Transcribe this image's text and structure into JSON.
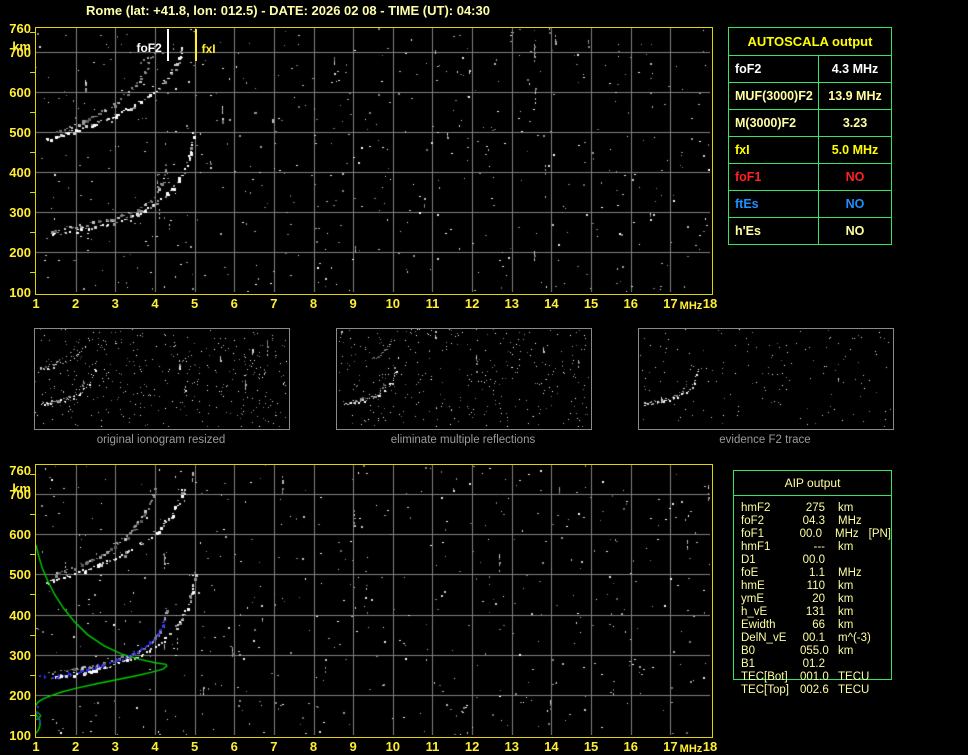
{
  "title": "Rome (lat: +41.8, lon: 012.5) - DATE: 2026 02 08 - TIME (UT): 04:30",
  "colors": {
    "background": "#000000",
    "axis_yellow": "#ffee33",
    "border_yellow": "#e3d400",
    "title_cream": "#ffffaa",
    "table_green": "#35e463",
    "grid_gray": "#808080",
    "caption_gray": "#9a9a9a",
    "value_cream": "#ffffa0",
    "red": "#ff2222",
    "blue": "#1e90ff",
    "profile_green": "#00cf00",
    "restored_trace_blue": "#2d2dff"
  },
  "plot": {
    "x_ticks": [
      "1",
      "2",
      "3",
      "4",
      "5",
      "6",
      "7",
      "8",
      "9",
      "10",
      "11",
      "12",
      "13",
      "14",
      "15",
      "16",
      "17",
      "18"
    ],
    "x_unit": "MHz",
    "y_ticks": [
      {
        "label": "760",
        "km": 760
      },
      {
        "label": "km",
        "km": 716
      },
      {
        "label": "700",
        "km": 700
      },
      {
        "label": "600",
        "km": 600
      },
      {
        "label": "500",
        "km": 500
      },
      {
        "label": "400",
        "km": 400
      },
      {
        "label": "300",
        "km": 300
      },
      {
        "label": "200",
        "km": 200
      },
      {
        "label": "100",
        "km": 100
      }
    ],
    "fof2_label": "foF2",
    "fxi_label": "fxI"
  },
  "autoscala": {
    "header": "AUTOSCALA output",
    "rows": [
      {
        "label": "foF2",
        "value": "4.3 MHz",
        "style": "cw"
      },
      {
        "label": "MUF(3000)F2",
        "value": "13.9 MHz",
        "style": "cc"
      },
      {
        "label": "M(3000)F2",
        "value": "3.23",
        "style": "cc"
      },
      {
        "label": "fxI",
        "value": "5.0 MHz",
        "style": "cy"
      },
      {
        "label": "foF1",
        "value": "NO",
        "style": "cr"
      },
      {
        "label": "ftEs",
        "value": "NO",
        "style": "cb"
      },
      {
        "label": "h'Es",
        "value": "NO",
        "style": "cc"
      }
    ]
  },
  "thumbnails": [
    {
      "caption": "original ionogram resized"
    },
    {
      "caption": "eliminate multiple reflections"
    },
    {
      "caption": "evidence F2 trace"
    }
  ],
  "aip": {
    "header": "AIP output",
    "rows": [
      {
        "name": "hmF2",
        "value": "275",
        "unit": "km",
        "extra": ""
      },
      {
        "name": "foF2",
        "value": "04.3",
        "unit": "MHz",
        "extra": ""
      },
      {
        "name": "foF1",
        "value": "00.0",
        "unit": "MHz",
        "extra": "[PN]"
      },
      {
        "name": "hmF1",
        "value": "---",
        "unit": "km",
        "extra": ""
      },
      {
        "name": "D1",
        "value": "00.0",
        "unit": "",
        "extra": ""
      },
      {
        "name": "foE",
        "value": "1.1",
        "unit": "MHz",
        "extra": ""
      },
      {
        "name": "hmE",
        "value": "110",
        "unit": "km",
        "extra": ""
      },
      {
        "name": "ymE",
        "value": "20",
        "unit": "km",
        "extra": ""
      },
      {
        "name": "h_vE",
        "value": "131",
        "unit": "km",
        "extra": ""
      },
      {
        "name": "Ewidth",
        "value": "66",
        "unit": "km",
        "extra": ""
      },
      {
        "name": "DelN_vE",
        "value": "00.1",
        "unit": "m^(-3)",
        "extra": ""
      },
      {
        "name": "B0",
        "value": "055.0",
        "unit": "km",
        "extra": ""
      },
      {
        "name": "B1",
        "value": "01.2",
        "unit": "",
        "extra": ""
      },
      {
        "name": "TEC[Bot]",
        "value": "001.0",
        "unit": "TECU",
        "extra": ""
      },
      {
        "name": "TEC[Top]",
        "value": "002.6",
        "unit": "TECU",
        "extra": ""
      }
    ]
  },
  "chart_data": {
    "type": "scatter",
    "description": "Ionogram: virtual height (km) vs sounding frequency (MHz), with AUTOSCALA traces",
    "x_axis": {
      "label": "MHz",
      "range": [
        1,
        18
      ],
      "grid_step": 1
    },
    "y_axis": {
      "label": "km",
      "range": [
        100,
        760
      ],
      "grid_step": 100
    },
    "critical": {
      "foF2_MHz": 4.3,
      "fxI_MHz": 5.0,
      "hmF2_km": 275
    },
    "traces": {
      "f2_x": [
        [
          1.4,
          244
        ],
        [
          1.8,
          250
        ],
        [
          2.2,
          257
        ],
        [
          2.6,
          265
        ],
        [
          3.0,
          276
        ],
        [
          3.4,
          289
        ],
        [
          3.7,
          302
        ],
        [
          3.95,
          317
        ],
        [
          4.2,
          335
        ],
        [
          4.4,
          355
        ],
        [
          4.6,
          378
        ],
        [
          4.75,
          404
        ],
        [
          4.85,
          430
        ],
        [
          4.92,
          458
        ],
        [
          4.97,
          488
        ],
        [
          4.99,
          508
        ]
      ],
      "f2_o": [
        [
          1.35,
          254
        ],
        [
          1.7,
          259
        ],
        [
          2.1,
          265
        ],
        [
          2.5,
          273
        ],
        [
          2.9,
          283
        ],
        [
          3.25,
          294
        ],
        [
          3.55,
          307
        ],
        [
          3.8,
          322
        ],
        [
          4.0,
          340
        ],
        [
          4.12,
          360
        ],
        [
          4.2,
          382
        ],
        [
          4.26,
          405
        ],
        [
          4.29,
          428
        ]
      ],
      "hop_o": [
        [
          1.45,
          498
        ],
        [
          1.8,
          510
        ],
        [
          2.15,
          524
        ],
        [
          2.5,
          540
        ],
        [
          2.85,
          560
        ],
        [
          3.15,
          583
        ],
        [
          3.45,
          612
        ],
        [
          3.7,
          645
        ],
        [
          3.9,
          680
        ],
        [
          4.03,
          715
        ]
      ],
      "hop_x": [
        [
          1.25,
          480
        ],
        [
          1.7,
          494
        ],
        [
          2.2,
          510
        ],
        [
          2.7,
          528
        ],
        [
          3.2,
          550
        ],
        [
          3.7,
          578
        ],
        [
          4.1,
          610
        ],
        [
          4.4,
          645
        ],
        [
          4.6,
          682
        ],
        [
          4.73,
          716
        ]
      ],
      "hop_x_upper": [
        [
          3.2,
          550
        ],
        [
          3.7,
          578
        ],
        [
          4.1,
          610
        ],
        [
          4.4,
          645
        ],
        [
          4.6,
          682
        ],
        [
          4.73,
          716
        ]
      ]
    },
    "profile": [
      [
        1.0,
        573
      ],
      [
        1.07,
        545
      ],
      [
        1.16,
        515
      ],
      [
        1.3,
        483
      ],
      [
        1.47,
        450
      ],
      [
        1.7,
        415
      ],
      [
        1.97,
        382
      ],
      [
        2.3,
        350
      ],
      [
        2.72,
        322
      ],
      [
        3.15,
        302
      ],
      [
        3.6,
        289
      ],
      [
        4.0,
        280
      ],
      [
        4.28,
        276
      ],
      [
        4.3,
        272
      ],
      [
        4.2,
        264
      ],
      [
        3.9,
        256
      ],
      [
        3.5,
        247
      ],
      [
        3.0,
        237
      ],
      [
        2.5,
        227
      ],
      [
        2.0,
        216
      ],
      [
        1.65,
        207
      ],
      [
        1.38,
        198
      ],
      [
        1.18,
        190
      ],
      [
        1.05,
        182
      ],
      [
        0.99,
        173
      ],
      [
        0.96,
        163
      ],
      [
        0.99,
        152
      ],
      [
        1.05,
        144
      ],
      [
        1.1,
        136
      ],
      [
        1.1,
        124
      ],
      [
        1.06,
        112
      ],
      [
        1.0,
        105
      ],
      [
        0.95,
        100
      ]
    ],
    "profile_loop": [
      [
        1.05,
        157
      ],
      [
        0.96,
        152
      ],
      [
        0.9,
        145
      ],
      [
        0.96,
        138
      ],
      [
        1.06,
        140
      ],
      [
        1.12,
        148
      ],
      [
        1.06,
        155
      ],
      [
        1.0,
        157
      ],
      [
        1.05,
        157
      ]
    ],
    "blue_trace": [
      [
        1.12,
        247
      ],
      [
        1.3,
        241
      ],
      [
        1.5,
        243
      ],
      [
        1.75,
        249
      ],
      [
        2.05,
        256
      ],
      [
        2.35,
        264
      ],
      [
        2.65,
        272
      ],
      [
        2.95,
        282
      ],
      [
        3.25,
        293
      ],
      [
        3.55,
        307
      ],
      [
        3.8,
        323
      ],
      [
        4.0,
        342
      ],
      [
        4.12,
        360
      ],
      [
        4.22,
        377
      ],
      [
        4.28,
        391
      ]
    ],
    "blue_e": [
      [
        1.04,
        170
      ],
      [
        1.0,
        156
      ],
      [
        1.04,
        144
      ],
      [
        1.1,
        137
      ]
    ],
    "views": {
      "top": {
        "seed": 11,
        "noise": 520,
        "streaks": 26,
        "step": 2,
        "gap": 0.25,
        "traces": [
          [
            "hop_o",
            "gray",
            2
          ],
          [
            "hop_x",
            "white",
            2
          ],
          [
            "f2_o",
            "gray",
            2
          ],
          [
            "f2_x",
            "white",
            2
          ]
        ]
      },
      "bottom": {
        "seed": 29,
        "noise": 500,
        "streaks": 24,
        "step": 2,
        "gap": 0.25,
        "profile": true,
        "blue": true,
        "traces": [
          [
            "hop_o",
            "gray",
            2
          ],
          [
            "hop_x",
            "white",
            2
          ],
          [
            "f2_o",
            "gray",
            2
          ],
          [
            "f2_x",
            "white",
            2
          ]
        ]
      },
      "thumbs": [
        {
          "seed": 41,
          "noise": 380,
          "streaks": 8,
          "step": 1.6,
          "gap": 0.3,
          "dot": 1,
          "traces": [
            [
              "hop_o",
              "gray",
              1
            ],
            [
              "hop_x",
              "white",
              1
            ],
            [
              "f2_o",
              "gray",
              1
            ],
            [
              "f2_x",
              "white",
              1
            ]
          ]
        },
        {
          "seed": 53,
          "noise": 340,
          "streaks": 6,
          "step": 1.6,
          "gap": 0.3,
          "dot": 1,
          "traces": [
            [
              "hop_x_upper",
              "gray",
              1
            ],
            [
              "f2_o",
              "gray",
              1
            ],
            [
              "f2_x",
              "white",
              1
            ]
          ]
        },
        {
          "seed": 67,
          "noise": 150,
          "streaks": 3,
          "step": 1.6,
          "gap": 0.3,
          "dot": 1,
          "traces": [
            [
              "f2_o",
              "gray",
              1
            ],
            [
              "f2_x",
              "white",
              1
            ]
          ]
        }
      ]
    }
  }
}
